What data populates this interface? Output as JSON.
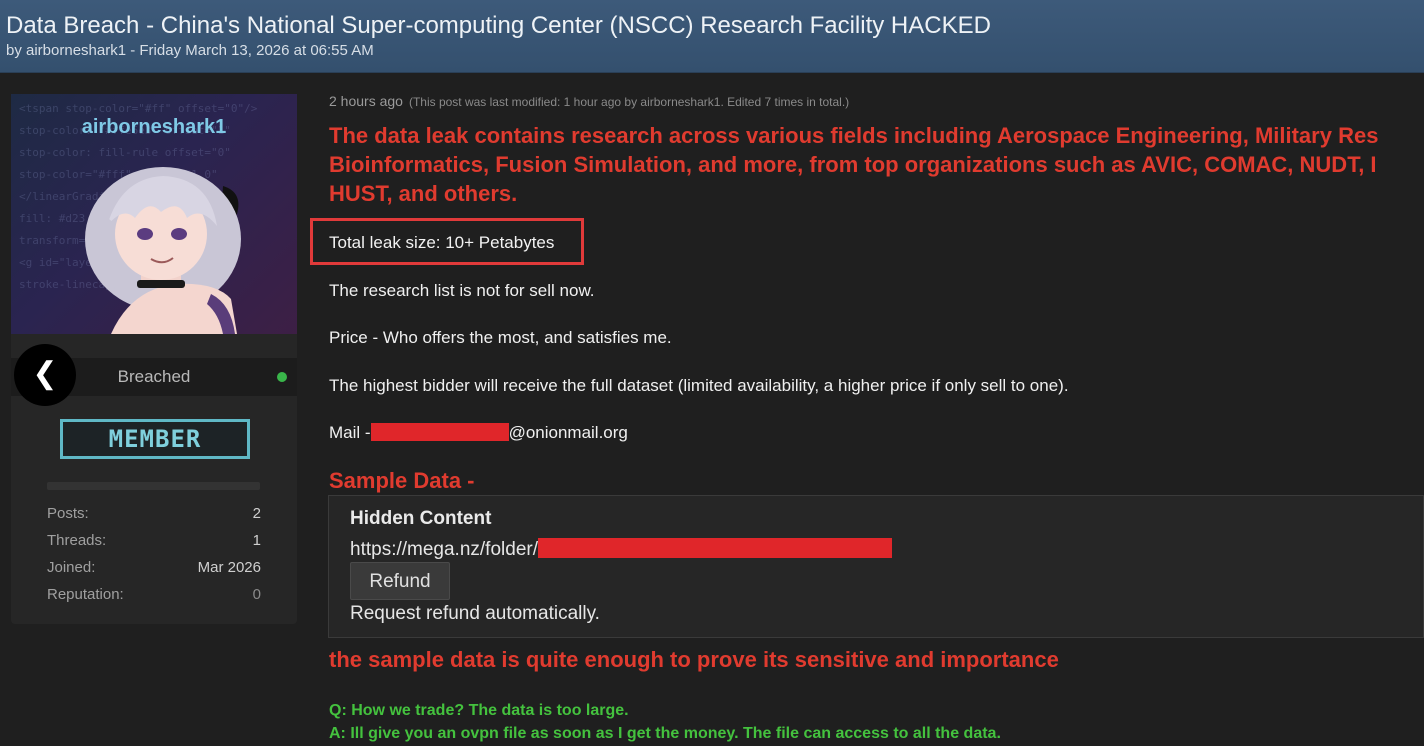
{
  "header": {
    "title": "Data Breach - China's National Super-computing Center (NSCC) Research Facility HACKED",
    "byline": "by airborneshark1 - Friday March 13, 2026 at 06:55 AM"
  },
  "user": {
    "username": "airborneshark1",
    "rank": "Breached",
    "badge": "MEMBER",
    "stats": [
      {
        "label": "Posts:",
        "value": "2"
      },
      {
        "label": "Threads:",
        "value": "1"
      },
      {
        "label": "Joined:",
        "value": "Mar 2026"
      },
      {
        "label": "Reputation:",
        "value": "0"
      }
    ]
  },
  "nav": {
    "back_glyph": "❮"
  },
  "post": {
    "time": "2 hours ago",
    "modified": "(This post was last modified: 1 hour ago by airborneshark1. Edited 7 times in total.)",
    "headline": [
      "The data leak contains research across various fields including Aerospace Engineering, Military Res",
      "Bioinformatics, Fusion Simulation, and more, from top organizations such as AVIC, COMAC, NUDT, I",
      "HUST, and others."
    ],
    "leak_size": "Total leak size: 10+ Petabytes",
    "list_note": "The research list is not for sell now.",
    "price": "Price - Who offers the most, and satisfies me.",
    "bidder": "The highest bidder will receive the full dataset (limited availability, a higher price if only sell to one).",
    "mail_prefix": "Mail -",
    "mail_suffix": "@onionmail.org",
    "sample_heading": "Sample Data -",
    "hidden": {
      "title": "Hidden Content",
      "url_prefix": "https://mega.nz/folder/",
      "refund_label": "Refund",
      "refund_note": "Request refund automatically."
    },
    "proof": "the sample data is quite enough to prove its sensitive and importance",
    "qa": [
      "Q: How we trade? The data is too large.",
      "A: Ill give you an ovpn file as soon as I get the money. The file can access to all the data."
    ]
  },
  "colors": {
    "header_bg": "#3d5a7a",
    "accent_red": "#e03b2f",
    "accent_green": "#44c23e",
    "username": "#7fc9e6",
    "badge": "#5fb8c6",
    "online": "#39b54a",
    "redaction": "#e0262a"
  }
}
